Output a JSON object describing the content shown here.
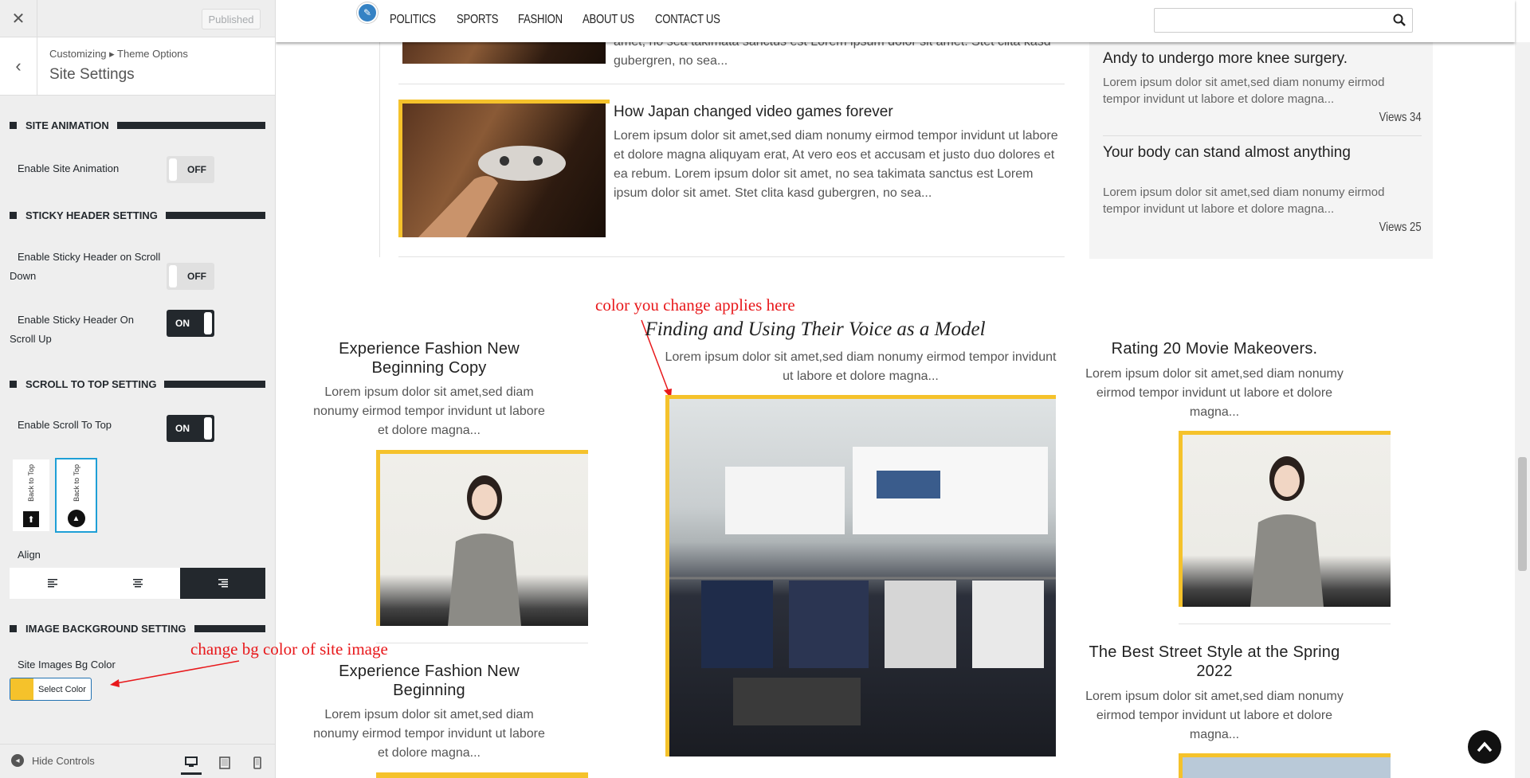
{
  "customizer": {
    "close_icon": "close-icon",
    "published": "Published",
    "breadcrumb": "Customizing ▸ Theme Options",
    "title": "Site Settings",
    "sections": {
      "site_animation": "SITE ANIMATION",
      "sticky_header": "STICKY HEADER SETTING",
      "scroll_top": "SCROLL TO TOP SETTING",
      "image_bg": "IMAGE BACKGROUND SETTING"
    },
    "enable_site_animation": {
      "label": "Enable Site Animation",
      "state": "OFF"
    },
    "sticky_scroll_down": {
      "label": "Enable Sticky Header on Scroll Down",
      "state": "OFF"
    },
    "sticky_scroll_up": {
      "label": "Enable Sticky Header On Scroll Up",
      "state": "ON"
    },
    "scroll_to_top": {
      "label": "Enable Scroll To Top",
      "state": "ON"
    },
    "back_to_top_options": [
      "Back to Top",
      "Back to Top"
    ],
    "align_label": "Align",
    "images_bg_label": "Site Images Bg Color",
    "select_color": "Select Color",
    "selected_color": "#f5c22b",
    "hide_controls": "Hide Controls"
  },
  "nav": {
    "items": [
      "POLITICS",
      "SPORTS",
      "FASHION",
      "ABOUT US",
      "CONTACT US"
    ],
    "search_placeholder": ""
  },
  "articles": {
    "top_excerpt": "amet, no sea takimata sanctus est Lorem ipsum dolor sit amet. Stet clita kasd gubergren, no sea...",
    "japan": {
      "title": "How Japan changed video games forever",
      "excerpt": "Lorem ipsum dolor sit amet,sed diam nonumy eirmod tempor invidunt ut labore et dolore magna aliquyam erat, At vero eos et accusam et justo duo dolores et ea rebum. Lorem ipsum dolor sit amet, no sea takimata sanctus est Lorem ipsum dolor sit amet. Stet clita kasd gubergren, no sea..."
    }
  },
  "popular": [
    {
      "title": "Andy to undergo more knee surgery.",
      "excerpt": "Lorem ipsum dolor sit amet,sed diam nonumy eirmod tempor invidunt ut labore et dolore magna...",
      "views": "Views 34"
    },
    {
      "title": "Your body can stand almost anything",
      "excerpt": "Lorem ipsum dolor sit amet,sed diam nonumy eirmod tempor invidunt ut labore et dolore magna...",
      "views": "Views 25"
    }
  ],
  "columns": {
    "left": [
      {
        "title": "Experience Fashion New Beginning Copy",
        "excerpt": "Lorem ipsum dolor sit amet,sed diam nonumy eirmod tempor invidunt ut labore et dolore magna..."
      },
      {
        "title": "Experience Fashion New Beginning",
        "excerpt": "Lorem ipsum dolor sit amet,sed diam nonumy eirmod tempor invidunt ut labore et dolore magna..."
      }
    ],
    "center": {
      "title": "Finding and Using Their Voice as a Model",
      "excerpt": "Lorem ipsum dolor sit amet,sed diam nonumy eirmod tempor invidunt ut labore et dolore magna..."
    },
    "right": [
      {
        "title": "Rating 20 Movie Makeovers.",
        "excerpt": "Lorem ipsum dolor sit amet,sed diam nonumy eirmod tempor invidunt ut labore et dolore magna..."
      },
      {
        "title": "The Best Street Style at the Spring 2022",
        "excerpt": "Lorem ipsum dolor sit amet,sed diam nonumy eirmod tempor invidunt ut labore et dolore magna..."
      }
    ]
  },
  "annotations": {
    "applies_here": "color you change applies here",
    "change_bg": "change bg color of site image"
  },
  "colors": {
    "accent": "#f5c22b",
    "dark": "#23282d",
    "annotation": "#e8181b"
  }
}
